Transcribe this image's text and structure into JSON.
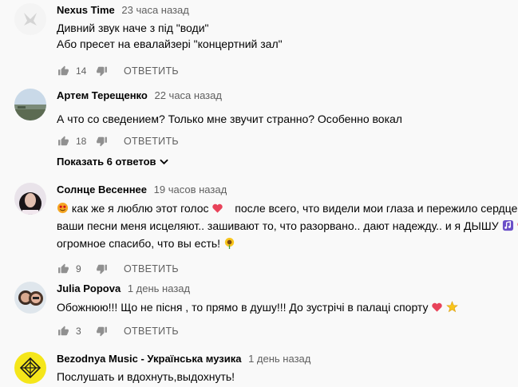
{
  "comments": [
    {
      "author": "Nexus Time",
      "time": "23 часа назад",
      "lines": [
        "Дивний звук наче з під \"води\"",
        "Або пресет на евалайзері \"концертний зал\""
      ],
      "likes": "14",
      "reply": "ОТВЕТИТЬ"
    },
    {
      "author": "Артем Терещенко",
      "time": "22 часа назад",
      "lines": [
        "А что со сведением? Только мне звучит странно? Особенно вокал"
      ],
      "likes": "18",
      "reply": "ОТВЕТИТЬ",
      "show_replies": "Показать 6 ответов"
    },
    {
      "author": "Солнце Весеннее",
      "time": "19 часов назад",
      "line1_a": "как же я люблю этот голос",
      "line1_b": "после всего, что видели мои глаза и пережило сердце -",
      "line2": "ваши песни меня исцеляют..  зашивают то, что разорвано.. дают надежду.. и я ДЫШУ",
      "line3": "огромное спасибо, что вы есть!",
      "likes": "9",
      "reply": "ОТВЕТИТЬ"
    },
    {
      "author": "Julia Popova",
      "time": "1 день назад",
      "line1": "Обожнюю!!! Що не пісня , то прямо в душу!!! До зустрічі в палаці спорту",
      "likes": "3",
      "reply": "ОТВЕТИТЬ"
    },
    {
      "author": "Bezodnya Music - Українська музика",
      "time": "1 день назад",
      "line1": "Послушать и вдохнуть,выдохнуть!"
    }
  ],
  "colors": {
    "text": "#030303",
    "secondary": "#606060",
    "background": "#f9f9f9",
    "icon": "#909090"
  },
  "icons": [
    "thumb-up-icon",
    "thumb-down-icon",
    "chevron-down-icon",
    "heart-emoji-icon",
    "star-emoji-icon",
    "smile-emoji-icon",
    "sunflower-emoji-icon"
  ]
}
